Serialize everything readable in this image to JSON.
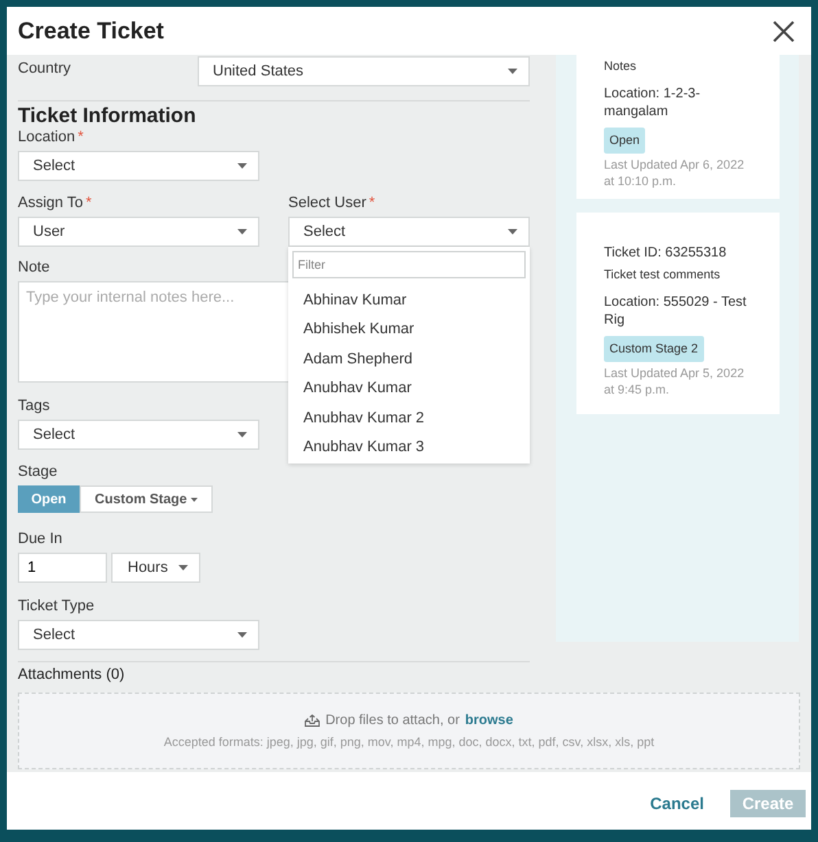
{
  "dialog": {
    "title": "Create Ticket"
  },
  "form": {
    "country": {
      "label": "Country",
      "value": "United States"
    },
    "section_title": "Ticket Information",
    "location": {
      "label": "Location",
      "required_mark": "*",
      "value": "Select"
    },
    "assign_to": {
      "label": "Assign To",
      "required_mark": "*",
      "value": "User"
    },
    "select_user": {
      "label": "Select User",
      "required_mark": "*",
      "value": "Select",
      "expanded": true,
      "filter_placeholder": "Filter",
      "options": [
        "Abhinav Kumar",
        "Abhishek Kumar",
        "Adam Shepherd",
        "Anubhav Kumar",
        "Anubhav Kumar 2",
        "Anubhav Kumar 3"
      ]
    },
    "note": {
      "label": "Note",
      "placeholder": "Type your internal notes here..."
    },
    "tags": {
      "label": "Tags",
      "value": "Select"
    },
    "stage": {
      "label": "Stage",
      "options": [
        {
          "label": "Open",
          "selected": true,
          "kind": "button"
        },
        {
          "label": "Custom Stage",
          "selected": false,
          "kind": "menu"
        }
      ]
    },
    "due_in": {
      "label": "Due In",
      "value": "1",
      "unit": "Hours"
    },
    "ticket_type": {
      "label": "Ticket Type",
      "value": "Select"
    },
    "attachments": {
      "label": "Attachments (0)",
      "drop_text": "Drop files to attach, or",
      "browse": "browse",
      "formats": "Accepted formats: jpeg, jpg, gif, png, mov, mp4, mpg, doc, docx, txt, pdf, csv, xlsx, xls, ppt"
    }
  },
  "tickets": [
    {
      "comment": "Notes",
      "location": "Location: 1-2-3-mangalam",
      "stage": "Open",
      "updated": "Last Updated Apr 6, 2022 at 10:10 p.m."
    },
    {
      "ticket_id": "Ticket ID: 63255318",
      "comment": "Ticket test comments",
      "location": "Location: 555029 - Test Rig",
      "stage": "Custom Stage 2",
      "updated": "Last Updated Apr 5, 2022 at 9:45 p.m."
    }
  ],
  "buttons": {
    "cancel": "Cancel",
    "create": {
      "label": "Create",
      "disabled": true
    }
  }
}
